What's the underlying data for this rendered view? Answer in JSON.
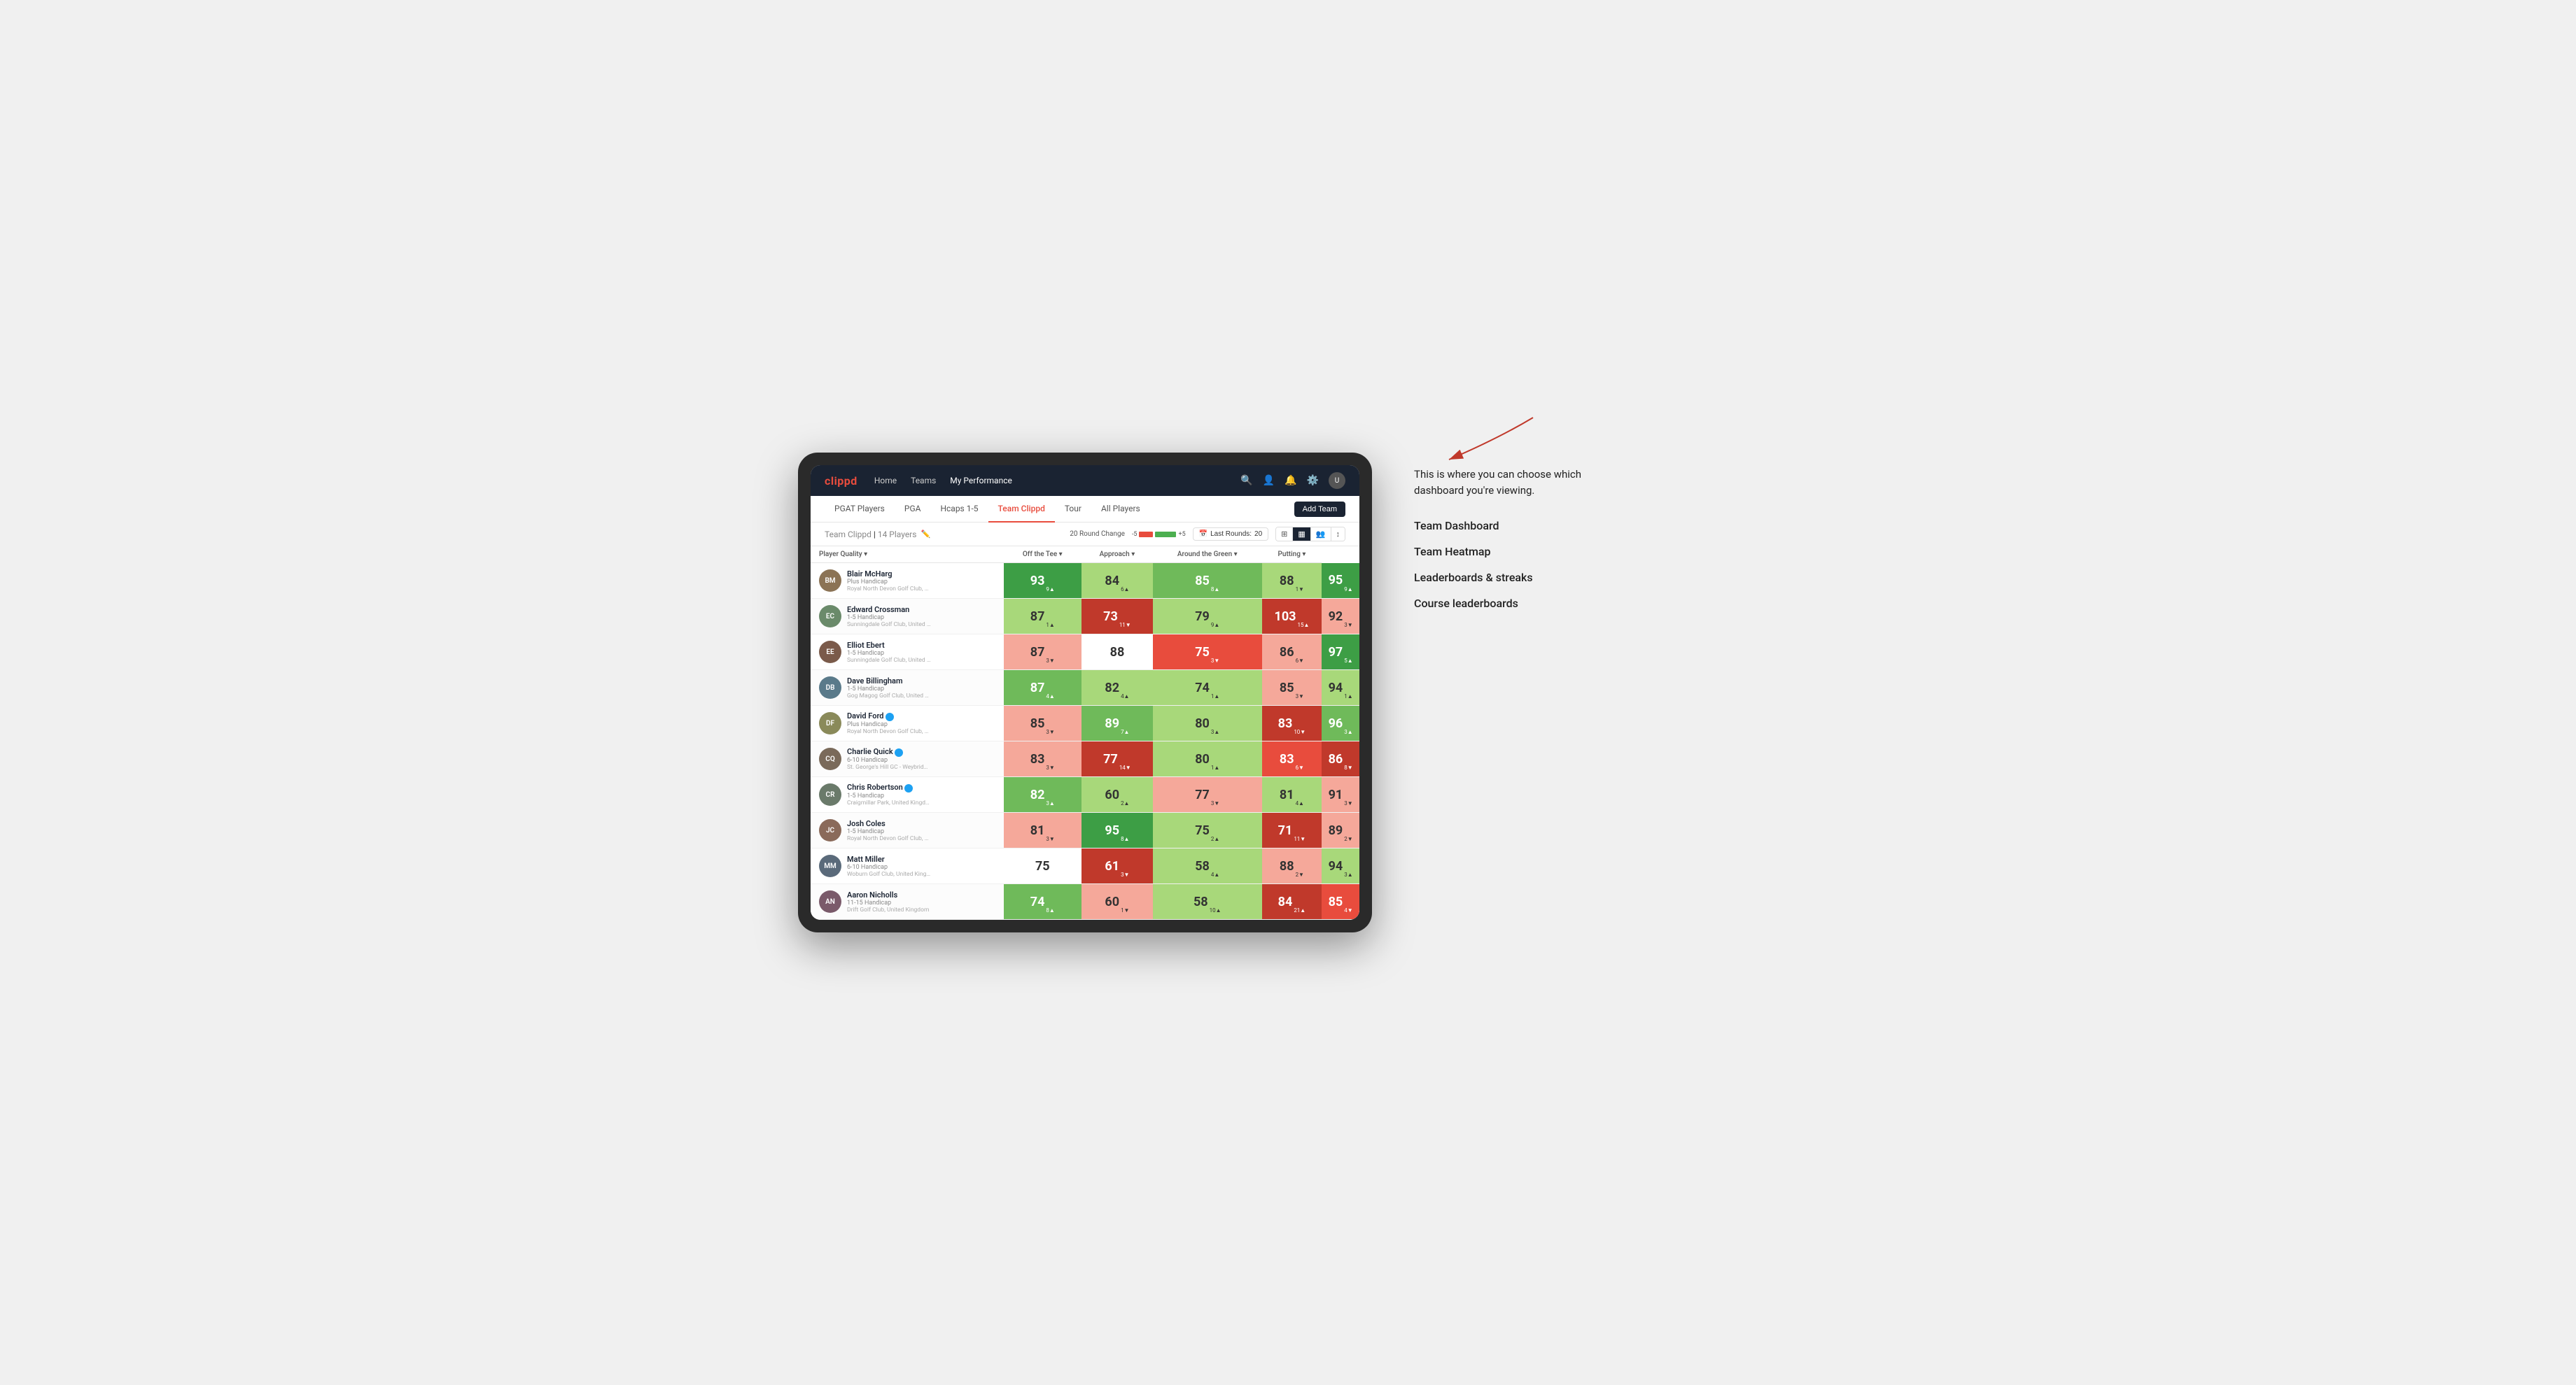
{
  "annotation": {
    "intro_text": "This is where you can choose which dashboard you're viewing.",
    "items": [
      "Team Dashboard",
      "Team Heatmap",
      "Leaderboards & streaks",
      "Course leaderboards"
    ]
  },
  "nav": {
    "logo": "clippd",
    "links": [
      {
        "label": "Home",
        "active": false
      },
      {
        "label": "Teams",
        "active": false
      },
      {
        "label": "My Performance",
        "active": true
      }
    ],
    "icons": [
      "search",
      "person",
      "bell",
      "settings",
      "avatar"
    ]
  },
  "sub_nav": {
    "links": [
      {
        "label": "PGAT Players",
        "active": false
      },
      {
        "label": "PGA",
        "active": false
      },
      {
        "label": "Hcaps 1-5",
        "active": false
      },
      {
        "label": "Team Clippd",
        "active": true
      },
      {
        "label": "Tour",
        "active": false
      },
      {
        "label": "All Players",
        "active": false
      }
    ],
    "add_team_label": "Add Team"
  },
  "team_header": {
    "title": "Team Clippd",
    "player_count": "14 Players",
    "round_change_label": "20 Round Change",
    "bar_left": "-5",
    "bar_right": "+5",
    "last_rounds_label": "Last Rounds:",
    "last_rounds_value": "20"
  },
  "table": {
    "col_headers": [
      "Player Quality ▾",
      "Off the Tee ▾",
      "Approach ▾",
      "Around the Green ▾",
      "Putting ▾"
    ],
    "players": [
      {
        "name": "Blair McHarg",
        "handicap": "Plus Handicap",
        "club": "Royal North Devon Golf Club, United Kingdom",
        "avatar_initials": "BM",
        "avatar_color": "#8b7355",
        "scores": [
          {
            "value": "93",
            "change": "9",
            "direction": "up",
            "color": "green-dark"
          },
          {
            "value": "84",
            "change": "6",
            "direction": "up",
            "color": "green-light"
          },
          {
            "value": "85",
            "change": "8",
            "direction": "up",
            "color": "green-mid"
          },
          {
            "value": "88",
            "change": "1",
            "direction": "down",
            "color": "green-light"
          },
          {
            "value": "95",
            "change": "9",
            "direction": "up",
            "color": "green-dark"
          }
        ]
      },
      {
        "name": "Edward Crossman",
        "handicap": "1-5 Handicap",
        "club": "Sunningdale Golf Club, United Kingdom",
        "avatar_initials": "EC",
        "avatar_color": "#6a8a6a",
        "scores": [
          {
            "value": "87",
            "change": "1",
            "direction": "up",
            "color": "green-light"
          },
          {
            "value": "73",
            "change": "11",
            "direction": "down",
            "color": "red-dark"
          },
          {
            "value": "79",
            "change": "9",
            "direction": "up",
            "color": "green-light"
          },
          {
            "value": "103",
            "change": "15",
            "direction": "up",
            "color": "red-dark"
          },
          {
            "value": "92",
            "change": "3",
            "direction": "down",
            "color": "red-light"
          }
        ]
      },
      {
        "name": "Elliot Ebert",
        "handicap": "1-5 Handicap",
        "club": "Sunningdale Golf Club, United Kingdom",
        "avatar_initials": "EE",
        "avatar_color": "#7a5a4a",
        "scores": [
          {
            "value": "87",
            "change": "3",
            "direction": "down",
            "color": "red-light"
          },
          {
            "value": "88",
            "change": "",
            "direction": "",
            "color": "white"
          },
          {
            "value": "75",
            "change": "3",
            "direction": "down",
            "color": "red-mid"
          },
          {
            "value": "86",
            "change": "6",
            "direction": "down",
            "color": "red-light"
          },
          {
            "value": "97",
            "change": "5",
            "direction": "up",
            "color": "green-dark"
          }
        ]
      },
      {
        "name": "Dave Billingham",
        "handicap": "1-5 Handicap",
        "club": "Gog Magog Golf Club, United Kingdom",
        "avatar_initials": "DB",
        "avatar_color": "#5a7a8a",
        "scores": [
          {
            "value": "87",
            "change": "4",
            "direction": "up",
            "color": "green-mid"
          },
          {
            "value": "82",
            "change": "4",
            "direction": "up",
            "color": "green-light"
          },
          {
            "value": "74",
            "change": "1",
            "direction": "up",
            "color": "green-light"
          },
          {
            "value": "85",
            "change": "3",
            "direction": "down",
            "color": "red-light"
          },
          {
            "value": "94",
            "change": "1",
            "direction": "up",
            "color": "green-light"
          }
        ]
      },
      {
        "name": "David Ford",
        "handicap": "Plus Handicap",
        "club": "Royal North Devon Golf Club, United Kingdom",
        "avatar_initials": "DF",
        "avatar_color": "#8a8a5a",
        "verified": true,
        "scores": [
          {
            "value": "85",
            "change": "3",
            "direction": "down",
            "color": "red-light"
          },
          {
            "value": "89",
            "change": "7",
            "direction": "up",
            "color": "green-mid"
          },
          {
            "value": "80",
            "change": "3",
            "direction": "up",
            "color": "green-light"
          },
          {
            "value": "83",
            "change": "10",
            "direction": "down",
            "color": "red-dark"
          },
          {
            "value": "96",
            "change": "3",
            "direction": "up",
            "color": "green-mid"
          }
        ]
      },
      {
        "name": "Charlie Quick",
        "handicap": "6-10 Handicap",
        "club": "St. George's Hill GC - Weybridge - Surrey, Uni...",
        "avatar_initials": "CQ",
        "avatar_color": "#7a6a5a",
        "verified": true,
        "scores": [
          {
            "value": "83",
            "change": "3",
            "direction": "down",
            "color": "red-light"
          },
          {
            "value": "77",
            "change": "14",
            "direction": "down",
            "color": "red-dark"
          },
          {
            "value": "80",
            "change": "1",
            "direction": "up",
            "color": "green-light"
          },
          {
            "value": "83",
            "change": "6",
            "direction": "down",
            "color": "red-mid"
          },
          {
            "value": "86",
            "change": "8",
            "direction": "down",
            "color": "red-dark"
          }
        ]
      },
      {
        "name": "Chris Robertson",
        "handicap": "1-5 Handicap",
        "club": "Craigmillar Park, United Kingdom",
        "avatar_initials": "CR",
        "avatar_color": "#6a7a6a",
        "verified": true,
        "scores": [
          {
            "value": "82",
            "change": "3",
            "direction": "up",
            "color": "green-mid"
          },
          {
            "value": "60",
            "change": "2",
            "direction": "up",
            "color": "green-light"
          },
          {
            "value": "77",
            "change": "3",
            "direction": "down",
            "color": "red-light"
          },
          {
            "value": "81",
            "change": "4",
            "direction": "up",
            "color": "green-light"
          },
          {
            "value": "91",
            "change": "3",
            "direction": "down",
            "color": "red-light"
          }
        ]
      },
      {
        "name": "Josh Coles",
        "handicap": "1-5 Handicap",
        "club": "Royal North Devon Golf Club, United Kingdom",
        "avatar_initials": "JC",
        "avatar_color": "#8a6a5a",
        "scores": [
          {
            "value": "81",
            "change": "3",
            "direction": "down",
            "color": "red-light"
          },
          {
            "value": "95",
            "change": "8",
            "direction": "up",
            "color": "green-dark"
          },
          {
            "value": "75",
            "change": "2",
            "direction": "up",
            "color": "green-light"
          },
          {
            "value": "71",
            "change": "11",
            "direction": "down",
            "color": "red-dark"
          },
          {
            "value": "89",
            "change": "2",
            "direction": "down",
            "color": "red-light"
          }
        ]
      },
      {
        "name": "Matt Miller",
        "handicap": "6-10 Handicap",
        "club": "Woburn Golf Club, United Kingdom",
        "avatar_initials": "MM",
        "avatar_color": "#5a6a7a",
        "scores": [
          {
            "value": "75",
            "change": "",
            "direction": "",
            "color": "white"
          },
          {
            "value": "61",
            "change": "3",
            "direction": "down",
            "color": "red-dark"
          },
          {
            "value": "58",
            "change": "4",
            "direction": "up",
            "color": "green-light"
          },
          {
            "value": "88",
            "change": "2",
            "direction": "down",
            "color": "red-light"
          },
          {
            "value": "94",
            "change": "3",
            "direction": "up",
            "color": "green-light"
          }
        ]
      },
      {
        "name": "Aaron Nicholls",
        "handicap": "11-15 Handicap",
        "club": "Drift Golf Club, United Kingdom",
        "avatar_initials": "AN",
        "avatar_color": "#7a5a6a",
        "scores": [
          {
            "value": "74",
            "change": "8",
            "direction": "up",
            "color": "green-mid"
          },
          {
            "value": "60",
            "change": "1",
            "direction": "down",
            "color": "red-light"
          },
          {
            "value": "58",
            "change": "10",
            "direction": "up",
            "color": "green-light"
          },
          {
            "value": "84",
            "change": "21",
            "direction": "up",
            "color": "red-dark"
          },
          {
            "value": "85",
            "change": "4",
            "direction": "down",
            "color": "red-mid"
          }
        ]
      }
    ]
  }
}
